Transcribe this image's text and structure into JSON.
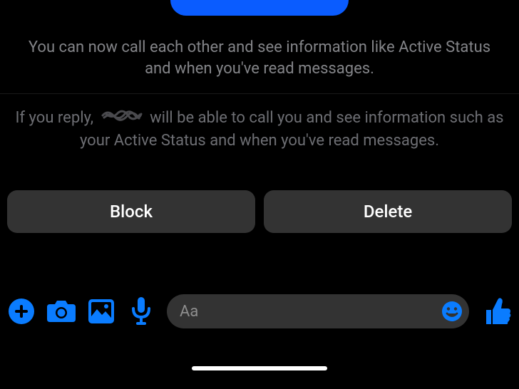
{
  "colors": {
    "accent": "#0a7cff",
    "button_bg": "#333333",
    "text_muted": "#838488",
    "text_dim": "#6d6e73"
  },
  "info_text_1": "You can now call each other and see information like Active Status and when you've read messages.",
  "reply_prefix": "If you reply,",
  "reply_suffix": "will be able to call you and see information such as your Active Status and when you've read messages.",
  "buttons": {
    "block": "Block",
    "delete": "Delete"
  },
  "compose": {
    "placeholder": "Aa"
  },
  "icons": {
    "plus": "plus-circle-icon",
    "camera": "camera-icon",
    "photo": "photo-icon",
    "mic": "microphone-icon",
    "emoji": "emoji-icon",
    "thumb": "thumbs-up-icon"
  }
}
